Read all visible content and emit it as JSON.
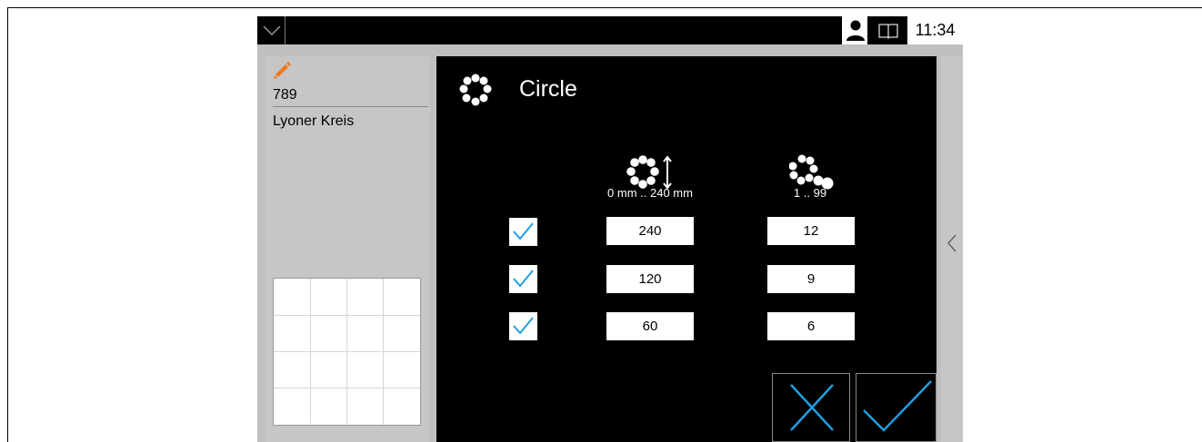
{
  "topbar": {
    "menu_icon": "chevron-down-icon",
    "user_icon": "user-icon",
    "book_icon": "book-icon",
    "time": "11:34"
  },
  "program": {
    "edit_icon": "pencil-icon",
    "number": "789",
    "name": "Lyoner Kreis"
  },
  "dialog": {
    "title": "Circle",
    "title_icon": "circle-pattern-icon",
    "columns": [
      {
        "icon": "circle-diameter-icon",
        "range": "0 mm .. 240 mm"
      },
      {
        "icon": "circle-count-icon",
        "range": "1 .. 99"
      }
    ],
    "rows": [
      {
        "checked": true,
        "diameter": "240",
        "count": "12"
      },
      {
        "checked": true,
        "diameter": "120",
        "count": "9"
      },
      {
        "checked": true,
        "diameter": "60",
        "count": "6"
      }
    ],
    "cancel_icon": "close-icon",
    "confirm_icon": "check-icon"
  },
  "side_panel": {
    "collapse_icon": "chevron-left-icon"
  },
  "colors": {
    "accent": "#1e9ee0",
    "edit_orange": "#f07820",
    "panel_gray": "#c6c6c6",
    "dialog_bg": "#000000"
  }
}
